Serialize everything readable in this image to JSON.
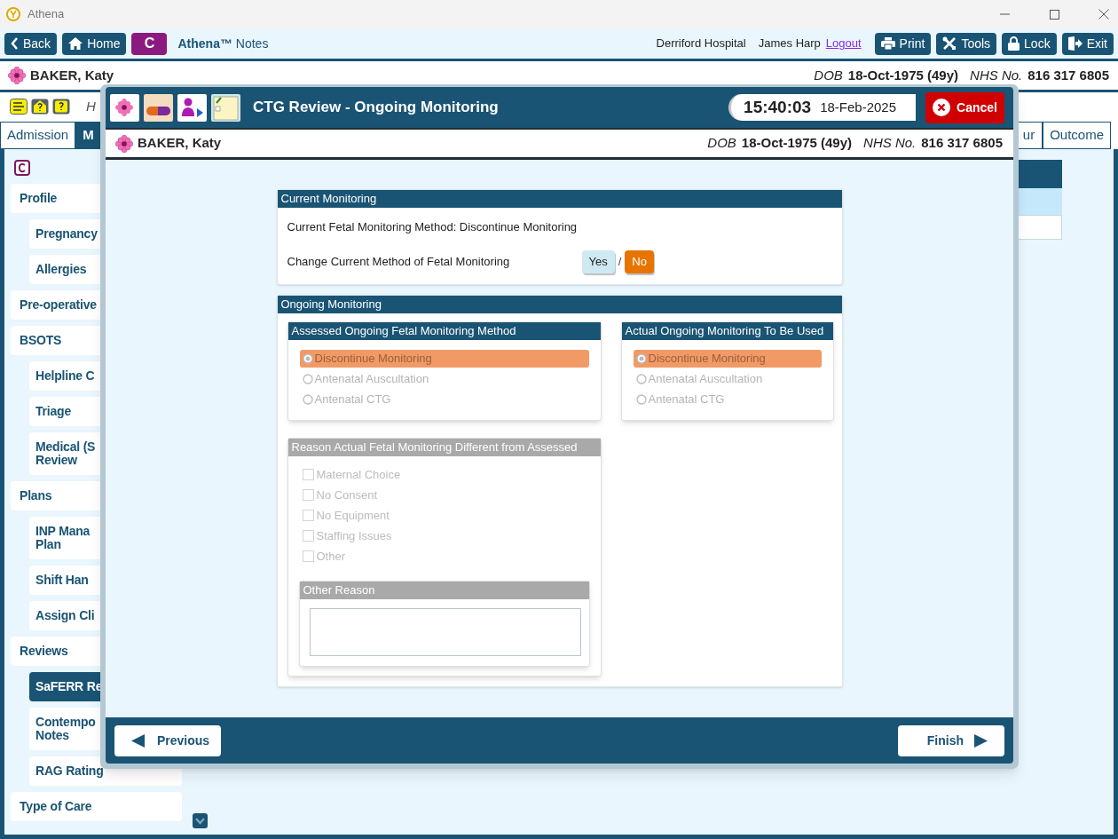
{
  "window": {
    "title": "Athena"
  },
  "toolbar": {
    "nav": [
      {
        "label": "Back",
        "kind": "back"
      },
      {
        "label": "Home",
        "kind": "home"
      }
    ],
    "badge": "C",
    "app_name": "**Athena™** Notes",
    "hospital": "Derriford Hospital",
    "user": "James Harp",
    "logout": "Logout",
    "actions": [
      {
        "label": "Print",
        "kind": "print"
      },
      {
        "label": "Tools",
        "kind": "tools"
      },
      {
        "label": "Lock",
        "kind": "lock"
      },
      {
        "label": "Exit",
        "kind": "exit"
      }
    ]
  },
  "patient": {
    "name": "BAKER, Katy",
    "dob_label": "DOB",
    "dob": "18-Oct-1975 (49y)",
    "nhs_label": "NHS No.",
    "nhs": "816 317 6805"
  },
  "subheader": {
    "text": "H"
  },
  "tabs": [
    {
      "label": "Admission",
      "selected": false
    },
    {
      "label": "M",
      "selected": true
    },
    {
      "label": "ur",
      "selected": false
    },
    {
      "label": "Outcome",
      "selected": false
    }
  ],
  "sidebar": {
    "items": [
      {
        "label": "Profile",
        "selected": false,
        "children": [
          {
            "label": "Pregnancy",
            "selected": false
          },
          {
            "label": "Allergies",
            "selected": false
          }
        ]
      },
      {
        "label": "Pre-operative",
        "selected": false
      },
      {
        "label": "BSOTS",
        "selected": false,
        "children": [
          {
            "label": "Helpline C",
            "selected": false
          },
          {
            "label": "Triage",
            "selected": false
          },
          {
            "label": "Medical (S\nReview",
            "selected": false
          }
        ]
      },
      {
        "label": "Plans",
        "selected": false,
        "children": [
          {
            "label": "INP Mana\nPlan",
            "selected": false
          },
          {
            "label": "Shift Han",
            "selected": false
          },
          {
            "label": "Assign Cli",
            "selected": false
          }
        ]
      },
      {
        "label": "Reviews",
        "selected": false,
        "children": [
          {
            "label": "SaFERR Re",
            "selected": true
          },
          {
            "label": "Contempo\nNotes",
            "selected": false
          },
          {
            "label": "RAG Rating",
            "selected": false
          }
        ]
      },
      {
        "label": "Type of Care",
        "selected": false
      }
    ]
  },
  "dialog": {
    "title": "CTG Review - Ongoing Monitoring",
    "time": "15:40:03",
    "date": "18-Feb-2025",
    "cancel": "Cancel",
    "patient": {
      "name": "BAKER, Katy",
      "dob_label": "DOB",
      "dob": "18-Oct-1975 (49y)",
      "nhs_label": "NHS No.",
      "nhs": "816 317 6805"
    },
    "current": {
      "title": "Current Monitoring",
      "method": "Current Fetal Monitoring Method: Discontinue Monitoring",
      "question": "Change Current Method of Fetal Monitoring",
      "separator": "/",
      "options": [
        {
          "label": "Yes",
          "selected": false
        },
        {
          "label": "No",
          "selected": true
        }
      ]
    },
    "ongoing": {
      "title": "Ongoing Monitoring",
      "groups": [
        {
          "title": "Assessed Ongoing Fetal Monitoring Method",
          "disabled": true,
          "options": [
            {
              "label": "Discontinue Monitoring",
              "selected": true
            },
            {
              "label": "Antenatal Auscultation",
              "selected": false
            },
            {
              "label": "Antenatal CTG",
              "selected": false
            }
          ]
        },
        {
          "title": "Actual Ongoing Monitoring To Be Used",
          "disabled": true,
          "options": [
            {
              "label": "Discontinue Monitoring",
              "selected": true
            },
            {
              "label": "Antenatal Auscultation",
              "selected": false
            },
            {
              "label": "Antenatal CTG",
              "selected": false
            }
          ]
        }
      ],
      "reason": {
        "title": "Reason Actual Fetal Monitoring Different from Assessed",
        "disabled": true,
        "checkboxes": [
          {
            "label": "Maternal Choice",
            "checked": false
          },
          {
            "label": "No Consent",
            "checked": false
          },
          {
            "label": "No Equipment",
            "checked": false
          },
          {
            "label": "Staffing Issues",
            "checked": false
          },
          {
            "label": "Other",
            "checked": false
          }
        ],
        "other_reason": {
          "title": "Other Reason"
        }
      }
    },
    "footer": {
      "previous": "Previous",
      "finish": "Finish"
    }
  }
}
